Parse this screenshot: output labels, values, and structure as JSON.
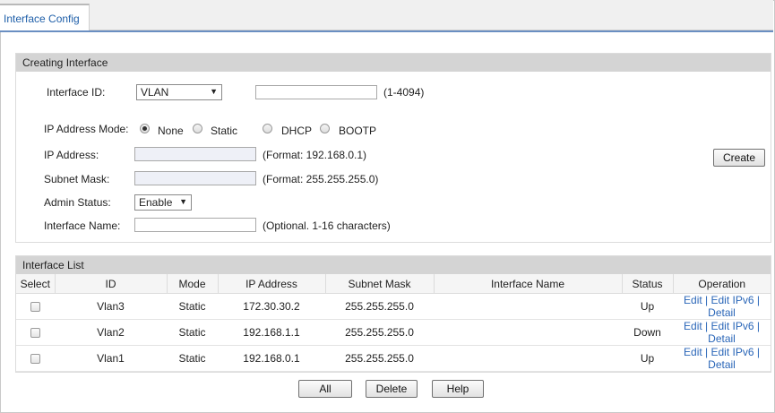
{
  "tab": {
    "label": "Interface Config"
  },
  "creating": {
    "title": "Creating Interface",
    "interface_id_label": "Interface ID:",
    "interface_type": "VLAN",
    "interface_id_value": "",
    "interface_id_hint": "(1-4094)",
    "ip_mode_label": "IP Address Mode:",
    "modes": [
      {
        "label": "None",
        "selected": true
      },
      {
        "label": "Static",
        "selected": false
      },
      {
        "label": "DHCP",
        "selected": false
      },
      {
        "label": "BOOTP",
        "selected": false
      }
    ],
    "ip_label": "IP Address:",
    "ip_value": "",
    "ip_hint": "(Format: 192.168.0.1)",
    "mask_label": "Subnet Mask:",
    "mask_value": "",
    "mask_hint": "(Format: 255.255.255.0)",
    "admin_label": "Admin Status:",
    "admin_value": "Enable",
    "name_label": "Interface Name:",
    "name_value": "",
    "name_hint": "(Optional. 1-16 characters)",
    "create_button": "Create"
  },
  "list": {
    "title": "Interface List",
    "columns": [
      "Select",
      "ID",
      "Mode",
      "IP Address",
      "Subnet Mask",
      "Interface Name",
      "Status",
      "Operation"
    ],
    "rows": [
      {
        "id": "Vlan3",
        "mode": "Static",
        "ip": "172.30.30.2",
        "mask": "255.255.255.0",
        "name": "",
        "status": "Up"
      },
      {
        "id": "Vlan2",
        "mode": "Static",
        "ip": "192.168.1.1",
        "mask": "255.255.255.0",
        "name": "",
        "status": "Down"
      },
      {
        "id": "Vlan1",
        "mode": "Static",
        "ip": "192.168.0.1",
        "mask": "255.255.255.0",
        "name": "",
        "status": "Up"
      }
    ],
    "ops": {
      "edit": "Edit",
      "sep": " | ",
      "edit_ipv6": "Edit IPv6",
      "detail": "Detail"
    },
    "buttons": {
      "all": "All",
      "delete": "Delete",
      "help": "Help"
    }
  }
}
